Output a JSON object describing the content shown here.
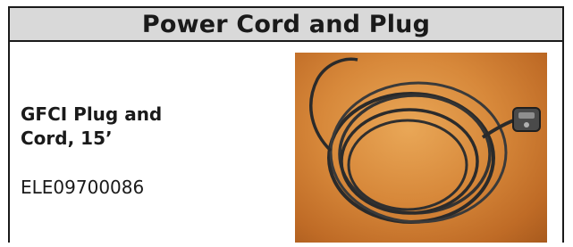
{
  "header": {
    "title": "Power Cord and Plug"
  },
  "product": {
    "name_line1": "GFCI Plug and",
    "name_line2": "Cord, 15’",
    "part_number": "ELE09700086"
  },
  "photo": {
    "subject": "coiled-power-cord-with-gfci-plug",
    "background_color": "#d7883a",
    "cord_color": "#2a2a2a"
  }
}
